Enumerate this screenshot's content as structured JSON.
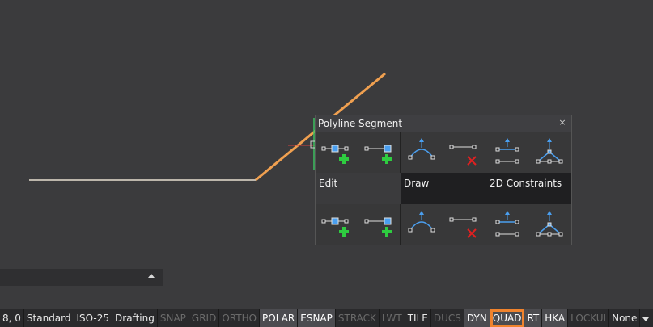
{
  "panel": {
    "title": "Polyline Segment",
    "close_glyph": "×",
    "categories": [
      {
        "label": "Edit",
        "active": true
      },
      {
        "label": "Draw",
        "active": false
      },
      {
        "label": "2D Constraints",
        "active": false
      }
    ],
    "tool_icons": [
      "add-vertex-icon",
      "extend-vertex-icon",
      "convert-to-arc-icon",
      "remove-vertex-icon",
      "horizontal-constraint-icon",
      "angle-constraint-icon"
    ]
  },
  "statusbar": {
    "items": [
      {
        "label": "8, 0",
        "state": "text"
      },
      {
        "label": "Standard",
        "state": "text"
      },
      {
        "label": "ISO-25",
        "state": "text"
      },
      {
        "label": "Drafting",
        "state": "text"
      },
      {
        "label": "SNAP",
        "state": "off"
      },
      {
        "label": "GRID",
        "state": "off"
      },
      {
        "label": "ORTHO",
        "state": "off"
      },
      {
        "label": "POLAR",
        "state": "on"
      },
      {
        "label": "ESNAP",
        "state": "on"
      },
      {
        "label": "STRACK",
        "state": "off"
      },
      {
        "label": "LWT",
        "state": "off"
      },
      {
        "label": "TILE",
        "state": "text"
      },
      {
        "label": "DUCS",
        "state": "off"
      },
      {
        "label": "DYN",
        "state": "on"
      },
      {
        "label": "QUAD",
        "state": "on",
        "highlight": true
      },
      {
        "label": "RT",
        "state": "on"
      },
      {
        "label": "HKA",
        "state": "on"
      },
      {
        "label": "LOCKUI",
        "state": "off"
      },
      {
        "label": "None",
        "state": "text"
      }
    ]
  },
  "colors": {
    "canvas": "#3b3b3d",
    "polyline": "#f0a050",
    "highlight": "#f0832d",
    "icon_blue": "#4a9ff0",
    "add_green": "#2ecc40",
    "remove_red": "#e02020"
  }
}
